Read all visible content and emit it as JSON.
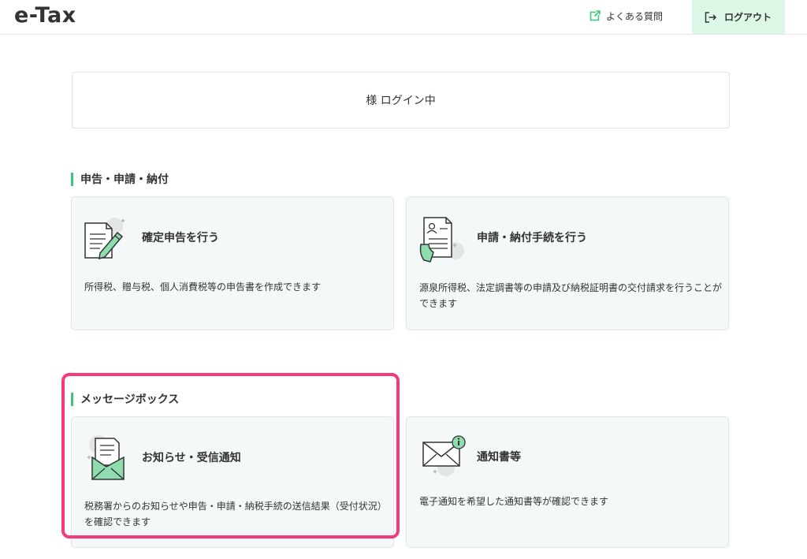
{
  "header": {
    "logo": "e-Tax",
    "faq_label": "よくある質問",
    "logout_label": "ログアウト"
  },
  "login_status": "様 ログイン中",
  "sections": [
    {
      "title": "申告・申請・納付",
      "cards": [
        {
          "title": "確定申告を行う",
          "description": "所得税、贈与税、個人消費税等の申告書を作成できます"
        },
        {
          "title": "申請・納付手続を行う",
          "description": "源泉所得税、法定調書等の申請及び納税証明書の交付請求を行うことができます"
        }
      ]
    },
    {
      "title": "メッセージボックス",
      "cards": [
        {
          "title": "お知らせ・受信通知",
          "description": "税務署からのお知らせや申告・申請・納税手続の送信結果（受付状況）を確認できます"
        },
        {
          "title": "通知書等",
          "description": "電子通知を希望した通知書等が確認できます"
        }
      ]
    }
  ],
  "colors": {
    "accent_green": "#3ec67a",
    "logout_bg": "#dcf7e6",
    "card_bg": "#f5f8f8",
    "highlight": "#f43a7c"
  }
}
